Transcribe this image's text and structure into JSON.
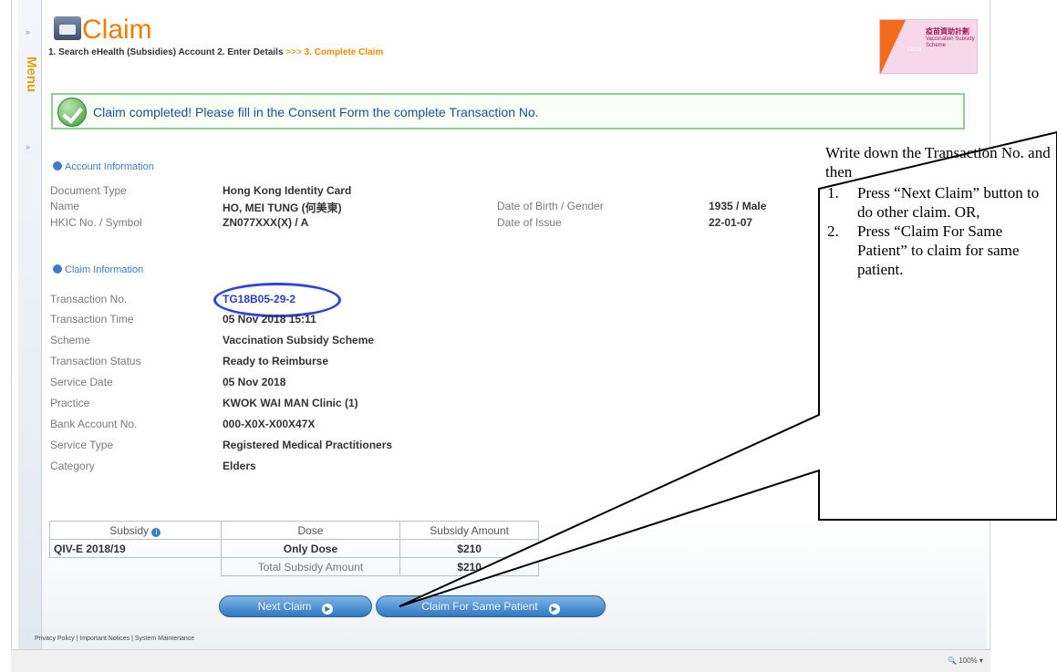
{
  "side_menu": {
    "label": "Menu",
    "collapse_glyph": "»",
    "expand_glyph": "»"
  },
  "header": {
    "title": "Claim",
    "steps": {
      "step1": "1. Search eHealth (Subsidies) Account",
      "step2": "2. Enter Details",
      "chevrons": ">>>",
      "step3": "3. Complete Claim"
    },
    "banner": {
      "title": "疫苗資助計劃",
      "subtitle": "Vaccination Subsidy Scheme",
      "year": "18/19"
    }
  },
  "success_message": "Claim completed! Please fill in the Consent Form the complete Transaction No.",
  "account_info": {
    "heading": "Account Information",
    "document_type_label": "Document Type",
    "document_type": "Hong Kong Identity Card",
    "name_label": "Name",
    "name": "HO, MEI TUNG (何美東)",
    "dob_gender_label": "Date of Birth / Gender",
    "dob_gender": "1935 / Male",
    "hkic_label": "HKIC No. / Symbol",
    "hkic": "ZN077XXX(X) / A",
    "doi_label": "Date of Issue",
    "doi": "22-01-07"
  },
  "claim_info": {
    "heading": "Claim Information",
    "transaction_no_label": "Transaction No.",
    "transaction_no": "TG18B05-29-2",
    "transaction_time_label": "Transaction Time",
    "transaction_time": "05 Nov 2018 15:11",
    "scheme_label": "Scheme",
    "scheme": "Vaccination Subsidy Scheme",
    "status_label": "Transaction Status",
    "status": "Ready to Reimburse",
    "service_date_label": "Service Date",
    "service_date": "05 Nov 2018",
    "practice_label": "Practice",
    "practice": "KWOK WAI MAN Clinic (1)",
    "bank_label": "Bank Account No.",
    "bank": "000-X0X-X00X47X",
    "service_type_label": "Service Type",
    "service_type": "Registered Medical Practitioners",
    "category_label": "Category",
    "category": "Elders"
  },
  "subsidy_table": {
    "headers": [
      "Subsidy",
      "Dose",
      "Subsidy Amount"
    ],
    "info_glyph": "i",
    "row": {
      "subsidy": "QIV-E 2018/19",
      "dose": "Only Dose",
      "amount": "$210"
    },
    "total_label": "Total Subsidy Amount",
    "total": "$210"
  },
  "buttons": {
    "next_claim": "Next Claim",
    "same_patient": "Claim For Same Patient",
    "arrow_glyph": "▶"
  },
  "footer": "Privacy Policy | Important Notices | System Maintenance",
  "statusbar": {
    "zoom": "100%",
    "zoom_caret": "▾"
  },
  "callout": {
    "intro": "Write down the Transaction No. and then",
    "items": [
      {
        "num": "1.",
        "text": "Press “Next Claim” button to do other claim. OR,"
      },
      {
        "num": "2.",
        "text": "Press “Claim For Same Patient” to claim for same patient."
      }
    ]
  }
}
